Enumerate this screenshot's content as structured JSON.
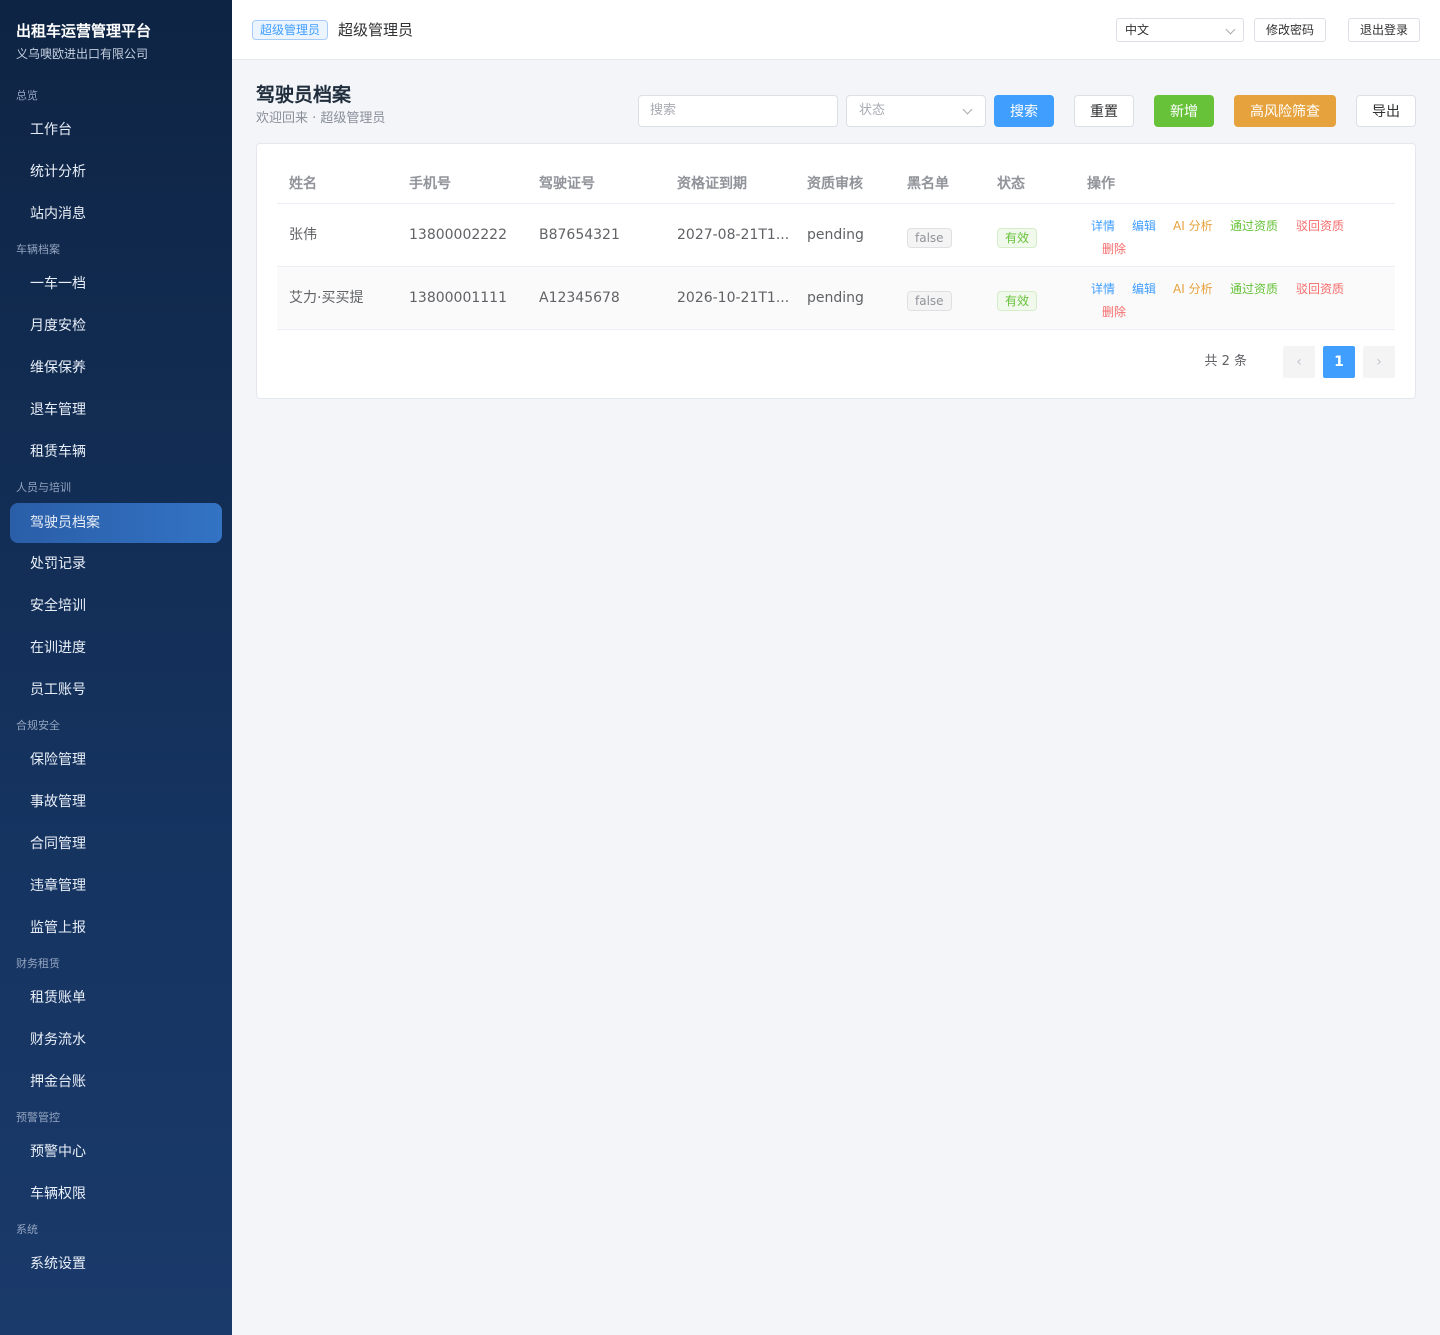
{
  "app": {
    "title": "出租车运营管理平台",
    "company": "义乌噢欧进出口有限公司"
  },
  "sidebar": {
    "groups": [
      {
        "label": "总览",
        "items": [
          "工作台",
          "统计分析",
          "站内消息"
        ]
      },
      {
        "label": "车辆档案",
        "items": [
          "一车一档",
          "月度安检",
          "维保保养",
          "退车管理",
          "租赁车辆"
        ]
      },
      {
        "label": "人员与培训",
        "items": [
          "驾驶员档案",
          "处罚记录",
          "安全培训",
          "在训进度",
          "员工账号"
        ]
      },
      {
        "label": "合规安全",
        "items": [
          "保险管理",
          "事故管理",
          "合同管理",
          "违章管理",
          "监管上报"
        ]
      },
      {
        "label": "财务租赁",
        "items": [
          "租赁账单",
          "财务流水",
          "押金台账"
        ]
      },
      {
        "label": "预警管控",
        "items": [
          "预警中心",
          "车辆权限"
        ]
      },
      {
        "label": "系统",
        "items": [
          "系统设置"
        ]
      }
    ],
    "active_item": "驾驶员档案"
  },
  "topbar": {
    "role_tag": "超级管理员",
    "user_name": "超级管理员",
    "language": "中文",
    "change_password": "修改密码",
    "logout": "退出登录"
  },
  "page": {
    "title": "驾驶员档案",
    "subtitle": "欢迎回来 · 超级管理员"
  },
  "filters": {
    "search_placeholder": "搜索",
    "status_placeholder": "状态"
  },
  "actions": {
    "search": "搜索",
    "reset": "重置",
    "add": "新增",
    "risk_screen": "高风险筛查",
    "export": "导出"
  },
  "table": {
    "columns": [
      "姓名",
      "手机号",
      "驾驶证号",
      "资格证到期",
      "资质审核",
      "黑名单",
      "状态",
      "操作"
    ],
    "rows": [
      {
        "name": "张伟",
        "phone": "13800002222",
        "license": "B87654321",
        "cert_expiry": "2027-08-21T1...",
        "review": "pending",
        "blacklist": "false",
        "status": "有效"
      },
      {
        "name": "艾力·买买提",
        "phone": "13800001111",
        "license": "A12345678",
        "cert_expiry": "2026-10-21T1...",
        "review": "pending",
        "blacklist": "false",
        "status": "有效"
      }
    ],
    "row_actions": {
      "detail": "详情",
      "edit": "编辑",
      "ai": "AI 分析",
      "approve": "通过资质",
      "reject": "驳回资质",
      "delete": "删除"
    }
  },
  "pagination": {
    "total_text": "共 2 条",
    "current_page": "1",
    "prev": "‹",
    "next": "›"
  },
  "colors": {
    "primary": "#409eff",
    "success": "#67c23a",
    "warning": "#e6a23c",
    "danger": "#f56c6c",
    "sidebar": "#0e2444"
  }
}
